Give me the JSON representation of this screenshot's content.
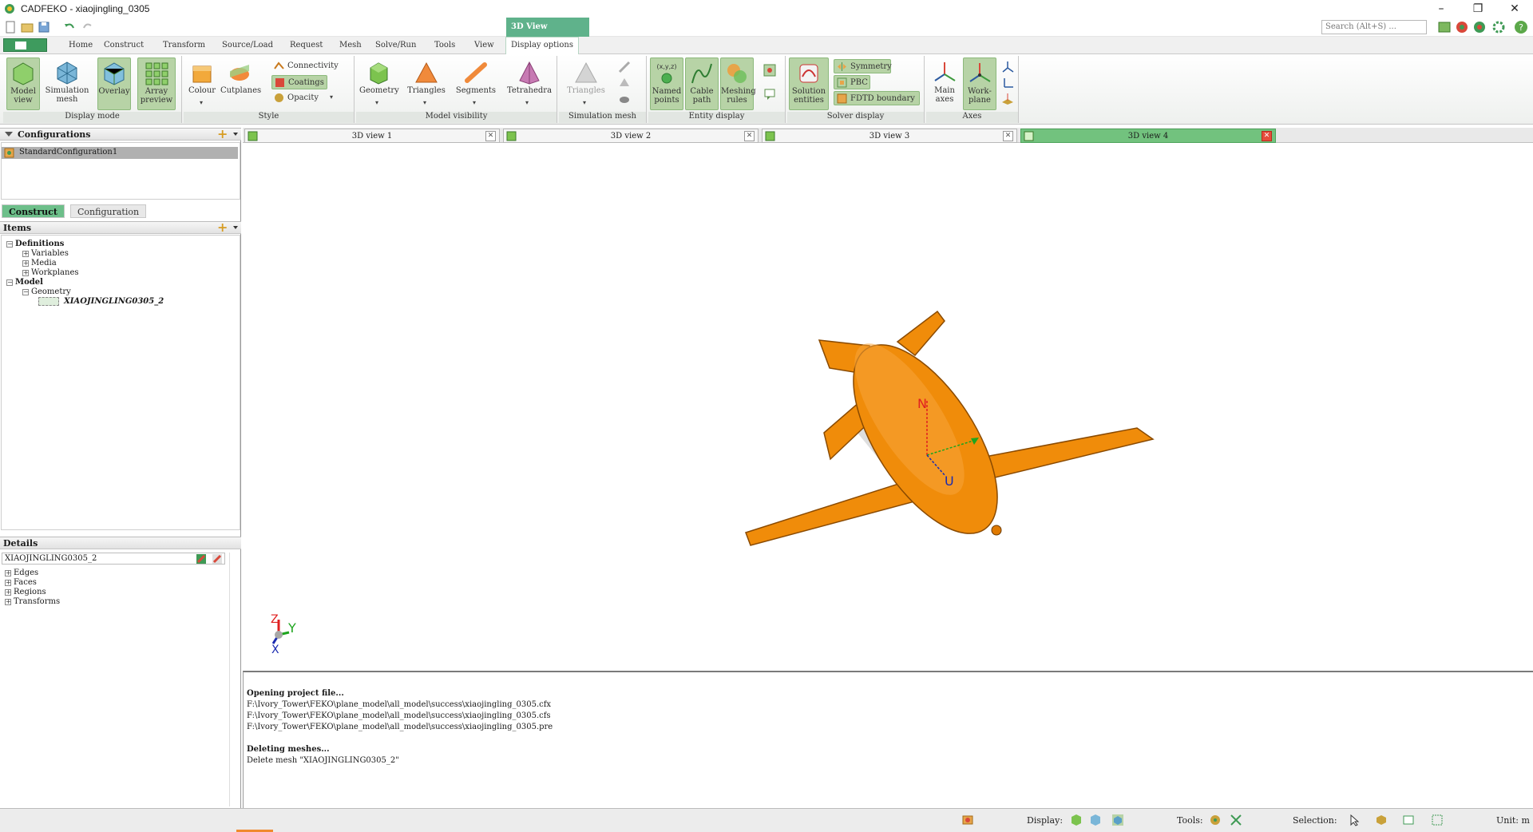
{
  "window": {
    "title": "CADFEKO - xiaojingling_0305"
  },
  "contextual_tab": "3D View",
  "search": {
    "placeholder": "Search (Alt+S) ..."
  },
  "ribbon_tabs": [
    "Home",
    "Construct",
    "Transform",
    "Source/Load",
    "Request",
    "Mesh",
    "Solve/Run",
    "Tools",
    "View",
    "Display options"
  ],
  "active_ribbon_tab": "Display options",
  "ribbon": {
    "display_mode": {
      "label": "Display mode",
      "buttons": [
        "Model view",
        "Simulation mesh",
        "Overlay",
        "Array preview"
      ]
    },
    "style": {
      "label": "Style",
      "buttons": [
        "Colour",
        "Cutplanes"
      ],
      "small": [
        "Connectivity",
        "Coatings",
        "Opacity"
      ]
    },
    "model_visibility": {
      "label": "Model visibility",
      "buttons": [
        "Geometry",
        "Triangles",
        "Segments",
        "Tetrahedra"
      ]
    },
    "simulation_mesh": {
      "label": "Simulation mesh",
      "buttons": [
        "Triangles"
      ]
    },
    "entity_display": {
      "label": "Entity display",
      "buttons": [
        "Named points",
        "Cable path",
        "Meshing rules"
      ]
    },
    "solver_display": {
      "label": "Solver display",
      "buttons": [
        "Solution entities"
      ],
      "small": [
        "Symmetry",
        "PBC",
        "FDTD boundary"
      ]
    },
    "axes": {
      "label": "Axes",
      "buttons": [
        "Main axes",
        "Work-plane"
      ]
    }
  },
  "left_panel": {
    "configurations": {
      "title": "Configurations",
      "selected": "StandardConfiguration1"
    },
    "tabs": [
      "Construct",
      "Configuration"
    ],
    "items": {
      "title": "Items",
      "tree": [
        {
          "label": "Definitions",
          "level": 0,
          "bold": true,
          "sign": "−"
        },
        {
          "label": "Variables",
          "level": 1,
          "sign": "+"
        },
        {
          "label": "Media",
          "level": 1,
          "sign": "+"
        },
        {
          "label": "Workplanes",
          "level": 1,
          "sign": "+"
        },
        {
          "label": "Model",
          "level": 0,
          "bold": true,
          "sign": "−"
        },
        {
          "label": "Geometry",
          "level": 1,
          "sign": "−"
        },
        {
          "label": "XIAOJINGLING0305_2",
          "level": 2,
          "italic": true
        }
      ]
    },
    "details": {
      "title": "Details",
      "selected": "XIAOJINGLING0305_2",
      "tree": [
        "Edges",
        "Faces",
        "Regions",
        "Transforms"
      ]
    }
  },
  "view_tabs": [
    "3D view 1",
    "3D view 2",
    "3D view 3",
    "3D view 4"
  ],
  "active_view_tab": "3D view 4",
  "viewport": {
    "model_color": "#f08c0a",
    "workplane_labels": {
      "n": "N",
      "u": "U"
    },
    "triad_labels": {
      "x": "X",
      "y": "Y",
      "z": "Z"
    }
  },
  "console": [
    {
      "text": "Opening project file...",
      "bold": true
    },
    {
      "text": "F:\\Ivory_Tower\\FEKO\\plane_model\\all_model\\success\\xiaojingling_0305.cfx"
    },
    {
      "text": "F:\\Ivory_Tower\\FEKO\\plane_model\\all_model\\success\\xiaojingling_0305.cfs"
    },
    {
      "text": "F:\\Ivory_Tower\\FEKO\\plane_model\\all_model\\success\\xiaojingling_0305.pre"
    },
    {
      "text": ""
    },
    {
      "text": "Deleting meshes...",
      "bold": true
    },
    {
      "text": "Delete mesh \"XIAOJINGLING0305_2\""
    }
  ],
  "status": {
    "display": "Display:",
    "tools": "Tools:",
    "selection": "Selection:",
    "unit": "Unit: m"
  }
}
